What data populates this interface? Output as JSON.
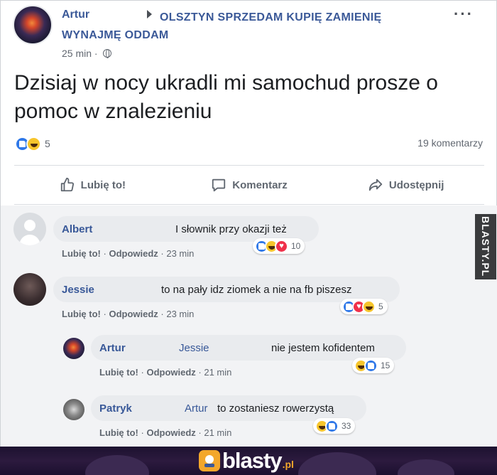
{
  "post": {
    "author": "Artur",
    "group": "OLSZTYN SPRZEDAM KUPIĘ ZAMIENIĘ WYNAJMĘ ODDAM",
    "time": "25 min",
    "privacy_icon": "globe-icon",
    "text": "Dzisiaj w nocy ukradli mi samochud prosze o pomoc w znalezieniu",
    "reactions": {
      "icons": [
        "like",
        "haha"
      ],
      "count": "5"
    },
    "comments_count": "19 komentarzy"
  },
  "actions": {
    "like": "Lubię to!",
    "comment": "Komentarz",
    "share": "Udostępnij"
  },
  "comments": [
    {
      "name": "Albert",
      "mention": "",
      "text": "I słownik przy okazji też",
      "like": "Lubię to!",
      "reply": "Odpowiedz",
      "time": "23 min",
      "reactions": [
        "like",
        "haha",
        "love"
      ],
      "count": "10"
    },
    {
      "name": "Jessie",
      "mention": "",
      "text": "to na pały idz ziomek a nie na fb piszesz",
      "like": "Lubię to!",
      "reply": "Odpowiedz",
      "time": "23 min",
      "reactions": [
        "like",
        "love",
        "haha"
      ],
      "count": "5"
    },
    {
      "name": "Artur",
      "mention": "Jessie",
      "text": "nie jestem kofidentem",
      "like": "Lubię to!",
      "reply": "Odpowiedz",
      "time": "21 min",
      "reactions": [
        "haha",
        "like"
      ],
      "count": "15"
    },
    {
      "name": "Patryk",
      "mention": "Artur",
      "text": "to zostaniesz rowerzystą",
      "like": "Lubię to!",
      "reply": "Odpowiedz",
      "time": "21 min",
      "reactions": [
        "haha",
        "like"
      ],
      "count": "33"
    }
  ],
  "watermark": {
    "side": "BLASTY.PL",
    "logo": "blasty",
    "logo_tld": ".pl"
  },
  "colors": {
    "link": "#3b5998",
    "like": "#2f78e8",
    "haha": "#f7c52c",
    "love": "#f0314b",
    "logo": "#f3a72b"
  }
}
